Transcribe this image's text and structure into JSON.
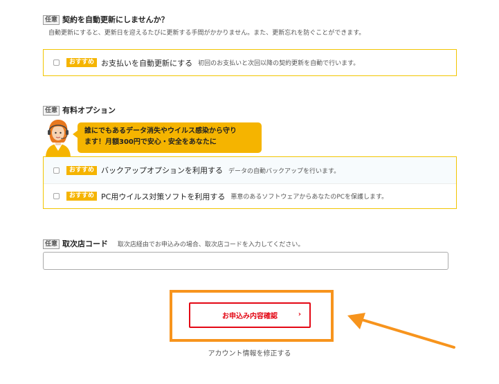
{
  "auto_renew": {
    "badge": "任意",
    "title": "契約を自動更新にしませんか？",
    "description": "自動更新にすると、更新日を迎えるたびに更新する手間がかかりません。また、更新忘れを防ぐことができます。",
    "option": {
      "recommend": "おすすめ",
      "label": "お支払いを自動更新にする",
      "description": "初回のお支払いと次回以降の契約更新を自動で行います。"
    }
  },
  "paid_options": {
    "badge": "任意",
    "title": "有料オプション",
    "bubble_line1": "誰にでもあるデータ消失やウイルス感染から守り",
    "bubble_line2": "ます！月額300円で安心・安全をあなたに",
    "items": [
      {
        "recommend": "おすすめ",
        "label": "バックアップオプションを利用する",
        "description": "データの自動バックアップを行います。"
      },
      {
        "recommend": "おすすめ",
        "label": "PC用ウイルス対策ソフトを利用する",
        "description": "悪意のあるソフトウェアからあなたのPCを保護します。"
      }
    ]
  },
  "agency_code": {
    "badge": "任意",
    "title": "取次店コード",
    "note": "取次店経由でお申込みの場合、取次店コードを入力してください。",
    "value": ""
  },
  "actions": {
    "confirm_label": "お申込み内容確認",
    "confirm_chevron": "›",
    "edit_account_label": "アカウント情報を修正する"
  },
  "colors": {
    "accent_yellow": "#f5b400",
    "option_border": "#f2c500",
    "highlight_orange": "#f7941d",
    "button_red": "#e30613"
  },
  "icons": {
    "checkbox": "checkbox-icon",
    "agent": "support-agent-icon",
    "arrow": "pointer-arrow-icon"
  }
}
